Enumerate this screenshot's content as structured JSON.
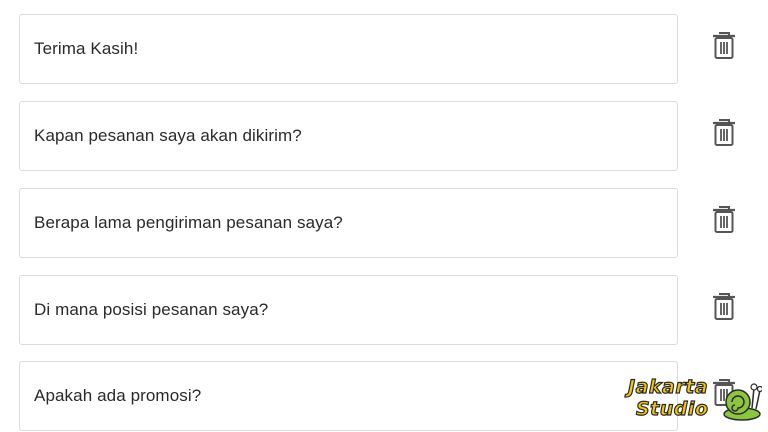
{
  "messages": [
    {
      "text": "Terima Kasih!",
      "delete_icon": "trash-icon"
    },
    {
      "text": "Kapan pesanan saya akan dikirim?",
      "delete_icon": "trash-icon"
    },
    {
      "text": "Berapa lama pengiriman pesanan saya?",
      "delete_icon": "trash-icon"
    },
    {
      "text": "Di mana posisi pesanan saya?",
      "delete_icon": "trash-icon"
    },
    {
      "text": "Apakah ada promosi?",
      "delete_icon": "trash-icon"
    }
  ],
  "watermark": {
    "line1": "Jakarta",
    "line2": "Studio"
  },
  "colors": {
    "border": "#dcdcdc",
    "text": "#2a2a2a",
    "icon": "#555555",
    "watermark_fill": "#f4c80f"
  }
}
